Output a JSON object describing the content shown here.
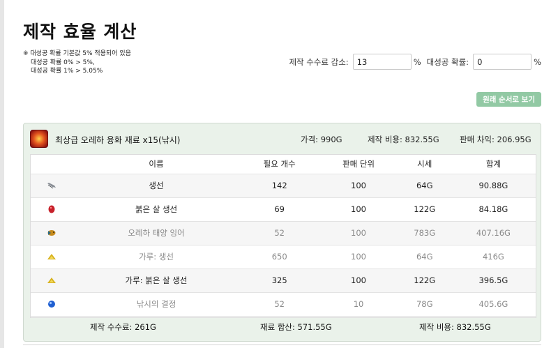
{
  "page": {
    "title": "제작 효율 계산",
    "note_lines": [
      "※ 대성공 확률 기본값 5% 적용되어 있음",
      "대성공 확률 0% > 5%,",
      "대성공 확률 1% > 5.05%"
    ]
  },
  "controls": {
    "fee_label": "제작 수수료 감소:",
    "fee_value": "13",
    "fee_unit": "%",
    "crit_label": "대성공 확률:",
    "crit_value": "0",
    "crit_unit": "%"
  },
  "reset_button": "원래 순서로 보기",
  "recipe": {
    "icon": "fusion-material-icon",
    "title": "최상급 오레하 융화 재료 x15(낚시)",
    "price": "가격: 990G",
    "cost": "제작 비용: 832.55G",
    "margin": "판매 차익: 206.95G",
    "columns": [
      "이름",
      "필요 개수",
      "판매 단위",
      "시세",
      "합계"
    ],
    "rows": [
      {
        "icon": "fish-icon",
        "name": "생선",
        "qty": "142",
        "unit": "100",
        "market": "64G",
        "total": "90.88G",
        "dim": false
      },
      {
        "icon": "red-fish-icon",
        "name": "붉은 살 생선",
        "qty": "69",
        "unit": "100",
        "market": "122G",
        "total": "84.18G",
        "dim": false
      },
      {
        "icon": "golden-fish-icon",
        "name": "오레하 태양 잉어",
        "qty": "52",
        "unit": "100",
        "market": "783G",
        "total": "407.16G",
        "dim": true
      },
      {
        "icon": "powder-icon",
        "name": "가루: 생선",
        "qty": "650",
        "unit": "100",
        "market": "64G",
        "total": "416G",
        "dim": true
      },
      {
        "icon": "powder-icon",
        "name": "가루: 붉은 살 생선",
        "qty": "325",
        "unit": "100",
        "market": "122G",
        "total": "396.5G",
        "dim": false
      },
      {
        "icon": "blue-crystal-icon",
        "name": "낚시의 결정",
        "qty": "52",
        "unit": "10",
        "market": "78G",
        "total": "405.6G",
        "dim": true
      }
    ],
    "footer": {
      "fee": "제작 수수료: 261G",
      "material_sum": "재료 합산: 571.55G",
      "craft_cost": "제작 비용: 832.55G"
    }
  }
}
